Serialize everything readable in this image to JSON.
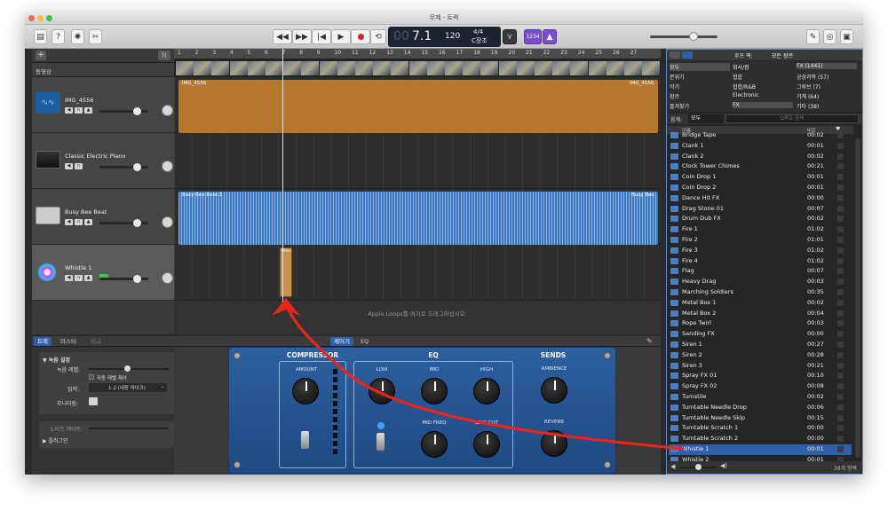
{
  "window": {
    "title": "무제 - 트랙"
  },
  "toolbar": {
    "lcd_time": "7.1",
    "lcd_bpm": "120",
    "lcd_sig": "4/4",
    "lcd_key": "C장조",
    "count_in": "1234",
    "dim_digits": "00"
  },
  "tracks_header": {
    "add": "+",
    "smart": "⟩⟨",
    "video_label": "동영상"
  },
  "ruler": {
    "marks": [
      "1",
      "2",
      "3",
      "4",
      "5",
      "6",
      "7",
      "8",
      "9",
      "10",
      "11",
      "12",
      "13",
      "14",
      "15",
      "16",
      "17",
      "18",
      "19",
      "20",
      "21",
      "22",
      "23",
      "24",
      "25",
      "26",
      "27"
    ]
  },
  "tracks": [
    {
      "name": "IMG_4556",
      "region": "IMG_4556",
      "region_end": "IMG_4556"
    },
    {
      "name": "Classic Electric Piano"
    },
    {
      "name": "Busy Bee Beat",
      "region": "Busy Bee Beat.1",
      "region_end": "Busy Bee"
    },
    {
      "name": "Whistle 1",
      "region": "Whis"
    }
  ],
  "drop_hint": "Apple Loops를 여기로 드래그하십시오.",
  "editor": {
    "tabs": {
      "track": "트랙",
      "master": "마스터",
      "compare": "비교",
      "controls": "제어기",
      "eq": "EQ"
    },
    "rec_section": "▼ 녹음 설정",
    "rec_level": "녹음 레벨:",
    "auto_level": "자동 레벨 제어",
    "input": "입력:",
    "input_value": "1-2 (내장 마이크)",
    "monitoring": "모니터링:",
    "noise_gate": "노이즈 게이트:",
    "plugins": "▶ 플러그인"
  },
  "plugin": {
    "compressor": "COMPRESSOR",
    "amount": "AMOUNT",
    "eq": "EQ",
    "low": "LOW",
    "mid": "MID",
    "high": "HIGH",
    "mid_freq": "MID FREQ",
    "low_cut": "LOW CUT",
    "sends": "SENDS",
    "ambience": "AMBIENCE",
    "reverb": "REVERB"
  },
  "browser": {
    "col1": [
      "모두",
      "분위기",
      "악기",
      "장르",
      "즐겨찾기"
    ],
    "col2": [
      "회사/점",
      "힙합",
      "힙합/R&B",
      "Electronic",
      "FX"
    ],
    "col3": [
      "FX (1441)",
      "공상과학 (57)",
      "그루브 (7)",
      "기계 (64)",
      "기타 (38)"
    ],
    "scale_label": "음계:",
    "scale_value": "모두",
    "search_placeholder": "Q루프 검색",
    "type_label": "루프 팩:",
    "type_value": "모든 장르",
    "header_name": "이름",
    "header_beats": "비트",
    "header_fav": "♥",
    "items": [
      {
        "name": "Bridge Tape",
        "time": "00:02"
      },
      {
        "name": "Clank 1",
        "time": "00:01"
      },
      {
        "name": "Clank 2",
        "time": "00:02"
      },
      {
        "name": "Clock Tower Chimes",
        "time": "00:21"
      },
      {
        "name": "Coin Drop 1",
        "time": "00:01"
      },
      {
        "name": "Coin Drop 2",
        "time": "00:01"
      },
      {
        "name": "Dance Hit FX",
        "time": "00:00"
      },
      {
        "name": "Drag Stone 01",
        "time": "00:07"
      },
      {
        "name": "Drum Dub FX",
        "time": "00:02"
      },
      {
        "name": "Fire 1",
        "time": "01:02"
      },
      {
        "name": "Fire 2",
        "time": "01:01"
      },
      {
        "name": "Fire 3",
        "time": "01:02"
      },
      {
        "name": "Fire 4",
        "time": "01:02"
      },
      {
        "name": "Flag",
        "time": "00:07"
      },
      {
        "name": "Heavy Drag",
        "time": "00:03"
      },
      {
        "name": "Marching Soldiers",
        "time": "00:35"
      },
      {
        "name": "Metal Box 1",
        "time": "00:02"
      },
      {
        "name": "Metal Box 2",
        "time": "00:04"
      },
      {
        "name": "Rope Twirl",
        "time": "00:03"
      },
      {
        "name": "Sanding FX",
        "time": "00:00"
      },
      {
        "name": "Siren 1",
        "time": "00:27"
      },
      {
        "name": "Siren 2",
        "time": "00:28"
      },
      {
        "name": "Siren 3",
        "time": "00:21"
      },
      {
        "name": "Spray FX 01",
        "time": "00:10"
      },
      {
        "name": "Spray FX 02",
        "time": "00:08"
      },
      {
        "name": "Turnstile",
        "time": "00:02"
      },
      {
        "name": "Turntable Needle Drop",
        "time": "00:06"
      },
      {
        "name": "Turntable Needle Skip",
        "time": "00:15"
      },
      {
        "name": "Turntable Scratch 1",
        "time": "00:00"
      },
      {
        "name": "Turntable Scratch 2",
        "time": "00:00"
      },
      {
        "name": "Whistle 1",
        "time": "00:01"
      },
      {
        "name": "Whistle 2",
        "time": "00:01"
      }
    ],
    "selected_index": 30,
    "count": "38개 항목"
  },
  "colors": {
    "audio_region": "#b5772e",
    "beat_region": "#3c78bd",
    "arrow": "#e8261c",
    "selection": "#2f5fa8"
  }
}
